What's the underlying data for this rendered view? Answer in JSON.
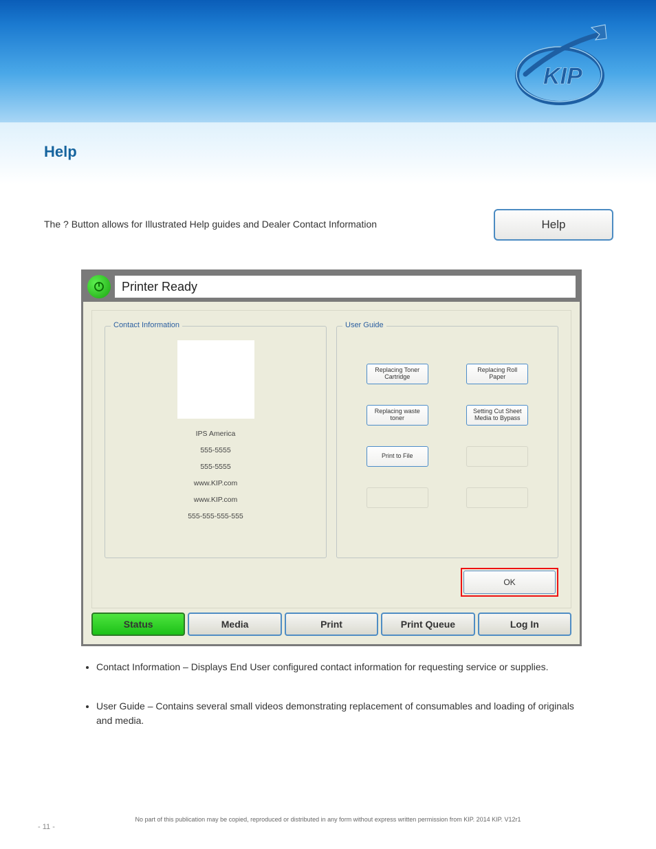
{
  "doc": {
    "heading": "Help",
    "body1": "The ? Button allows for Illustrated Help guides and Dealer Contact Information",
    "help_btn": "Help",
    "bullets": [
      "Contact Information – Displays End User configured contact information for requesting service or supplies.",
      "User Guide – Contains several small videos demonstrating replacement of consumables and loading of originals and media."
    ],
    "footer1": "No part of this publication may be copied, reproduced or distributed in any form without express written permission from KIP.   2014 KIP. V12r1",
    "copyright": "©",
    "page_num": "- 11 -"
  },
  "screenshot": {
    "title": "Printer Ready",
    "contact": {
      "legend": "Contact Information",
      "lines": [
        "IPS America",
        "555-5555",
        "555-5555",
        "www.KIP.com",
        "www.KIP.com",
        "555-555-555-555"
      ]
    },
    "guide": {
      "legend": "User Guide",
      "buttons": [
        "Replacing Toner Cartridge",
        "Replacing Roll Paper",
        "Replacing waste toner",
        "Setting Cut Sheet Media to Bypass",
        "Print to File",
        "",
        "",
        ""
      ]
    },
    "ok": "OK",
    "tabs": [
      "Status",
      "Media",
      "Print",
      "Print Queue",
      "Log In"
    ]
  }
}
